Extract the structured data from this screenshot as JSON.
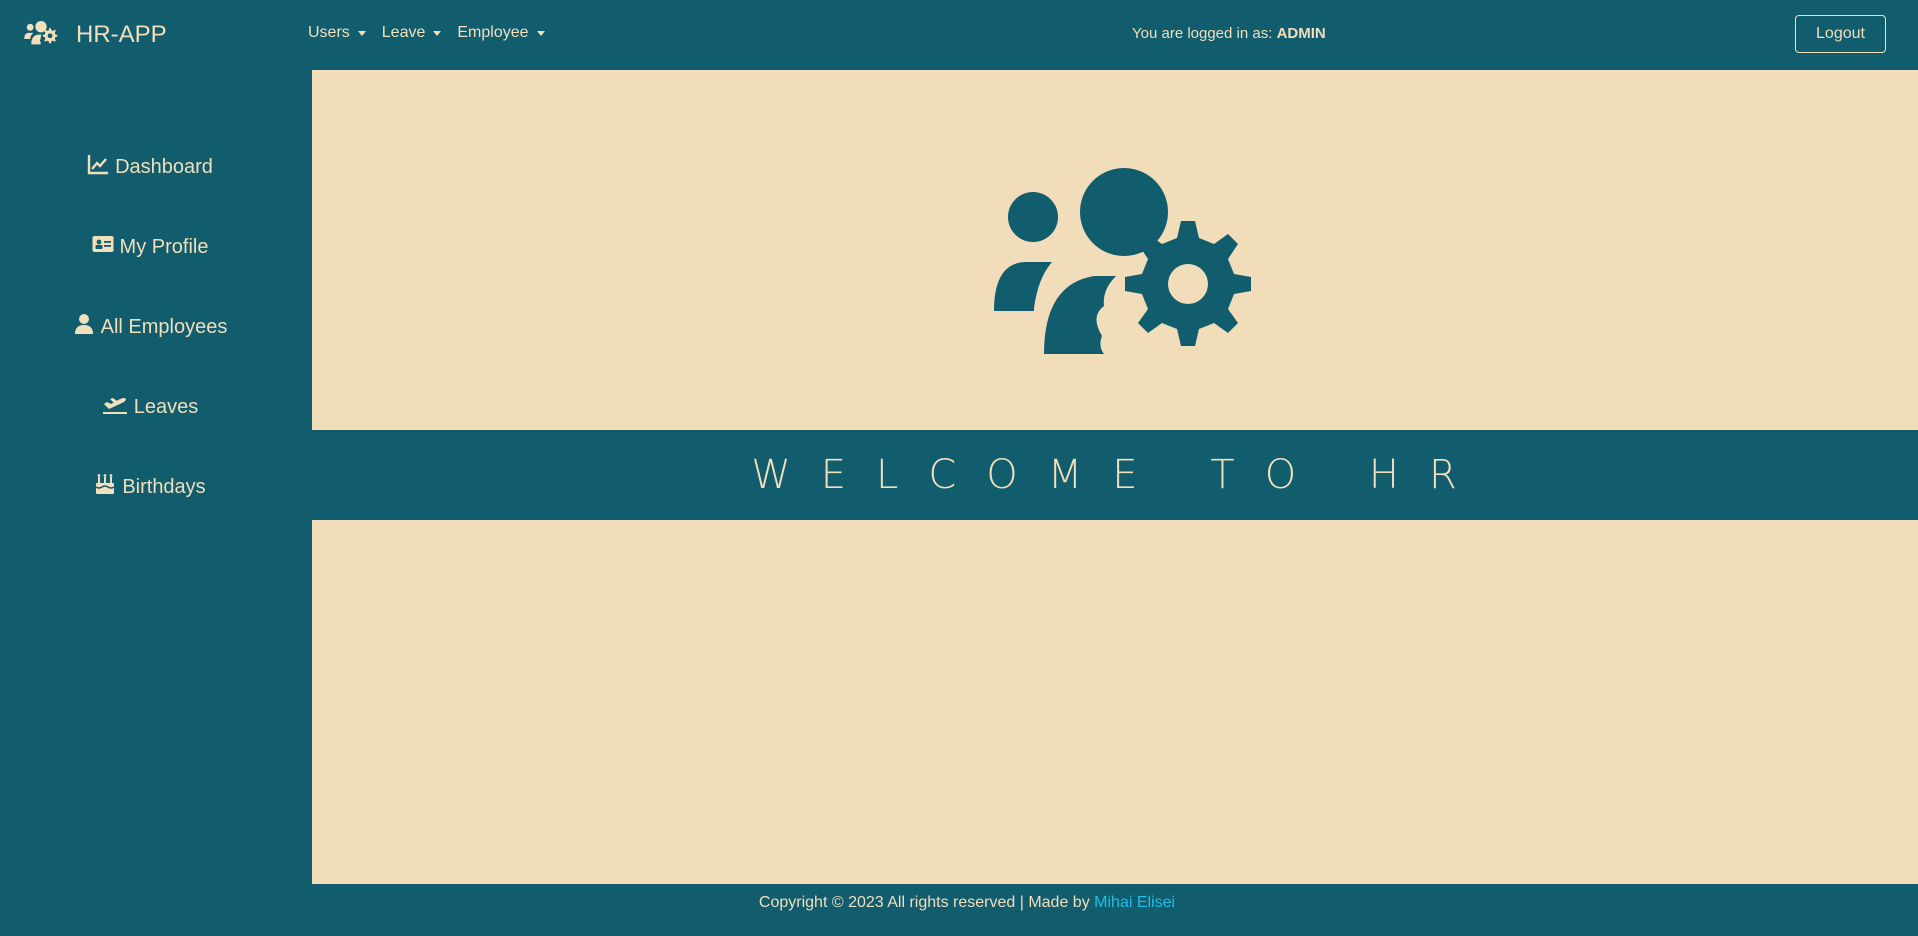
{
  "app": {
    "name": "HR-APP",
    "logo_icon": "users-gear-icon"
  },
  "nav": {
    "menus": [
      {
        "label": "Users"
      },
      {
        "label": "Leave"
      },
      {
        "label": "Employee"
      }
    ],
    "login_prefix": "You are logged in as:",
    "login_user": "ADMIN",
    "logout_label": "Logout"
  },
  "sidebar": {
    "items": [
      {
        "label": "Dashboard",
        "icon": "chart-line-icon"
      },
      {
        "label": "My Profile",
        "icon": "id-card-icon"
      },
      {
        "label": "All Employees",
        "icon": "user-icon"
      },
      {
        "label": "Leaves",
        "icon": "plane-departure-icon"
      },
      {
        "label": "Birthdays",
        "icon": "birthday-cake-icon"
      }
    ]
  },
  "main": {
    "hero_icon": "users-gear-icon",
    "welcome_text": "WELCOME TO HR"
  },
  "footer": {
    "copyright": "Copyright © 2023 All rights reserved | Made by",
    "author": "Mihai Elisei"
  },
  "colors": {
    "primary": "#115c6d",
    "cream": "#f2ddbb",
    "link": "#1ec0e6"
  }
}
